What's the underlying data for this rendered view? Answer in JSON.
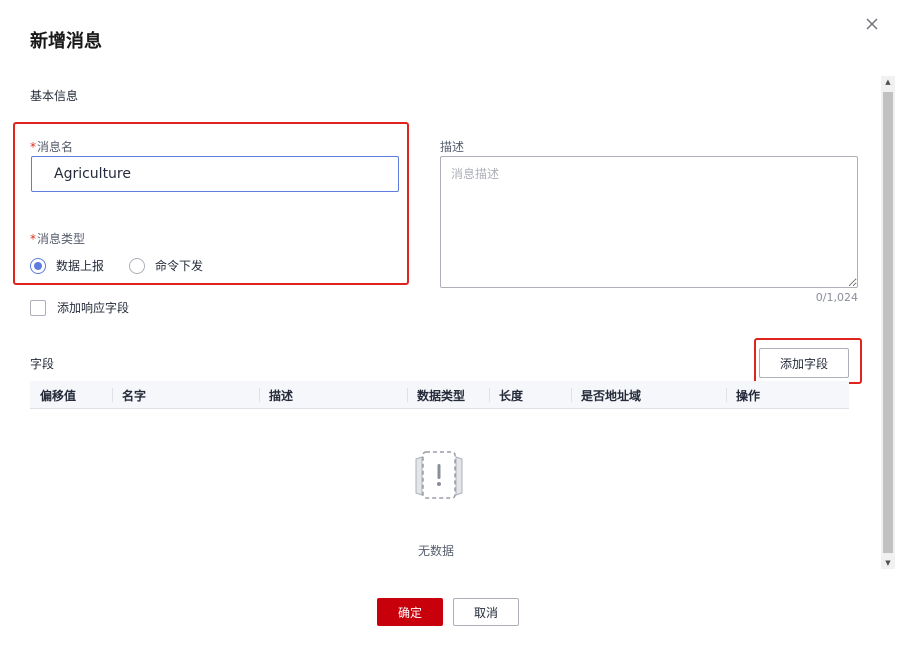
{
  "dialog": {
    "title": "新增消息",
    "close_icon": "close-icon"
  },
  "basic_info": {
    "section_title": "基本信息",
    "message_name": {
      "required_mark": "*",
      "label": "消息名",
      "value": "Agriculture"
    },
    "message_type": {
      "required_mark": "*",
      "label": "消息类型",
      "options": [
        {
          "label": "数据上报",
          "checked": true
        },
        {
          "label": "命令下发",
          "checked": false
        }
      ]
    },
    "description": {
      "label": "描述",
      "placeholder": "消息描述",
      "value": "",
      "counter": "0/1,024"
    },
    "add_response_field": {
      "label": "添加响应字段",
      "checked": false
    }
  },
  "fields": {
    "section_title": "字段",
    "add_button_label": "添加字段",
    "columns": [
      "偏移值",
      "名字",
      "描述",
      "数据类型",
      "长度",
      "是否地址域",
      "操作"
    ],
    "rows": [],
    "empty_text": "无数据",
    "empty_icon": "empty-box-icon"
  },
  "footer": {
    "ok_label": "确定",
    "cancel_label": "取消"
  },
  "colors": {
    "primary": "#c7000b",
    "accent_blue": "#5e7ce0",
    "highlight_red": "#e0231d",
    "required": "#e02f1f"
  }
}
